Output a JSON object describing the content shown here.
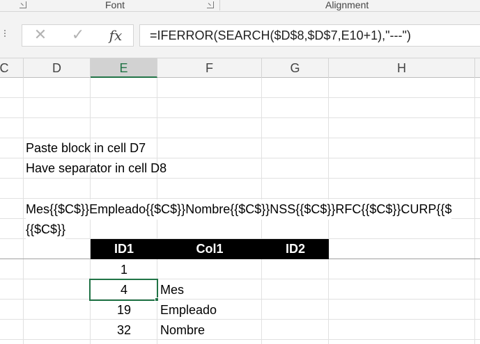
{
  "ribbon": {
    "groups": [
      {
        "label": "Font"
      },
      {
        "label": "Alignment"
      }
    ]
  },
  "formula_bar": {
    "cancel_icon": "✕",
    "enter_icon": "✓",
    "fx_label": "fx",
    "formula": "=IFERROR(SEARCH($D$8,$D$7,E10+1),\"---\")"
  },
  "columns": [
    "C",
    "D",
    "E",
    "F",
    "G",
    "H"
  ],
  "active_column": "E",
  "sheet": {
    "note1": "Paste block in cell D7",
    "note2": "Have separator in cell D8",
    "block_line1": "Mes{{$C$}}Empleado{{$C$}}Nombre{{$C$}}NSS{{$C$}}RFC{{$C$}}CURP{{$",
    "block_line2": "{{$C$}}",
    "table_headers": [
      "ID1",
      "Col1",
      "ID2"
    ],
    "rows": [
      {
        "id1": "1",
        "col1": ""
      },
      {
        "id1": "4",
        "col1": "Mes"
      },
      {
        "id1": "19",
        "col1": "Empleado"
      },
      {
        "id1": "32",
        "col1": "Nombre"
      }
    ]
  },
  "colors": {
    "accent": "#217346",
    "header_bg": "#000000"
  }
}
